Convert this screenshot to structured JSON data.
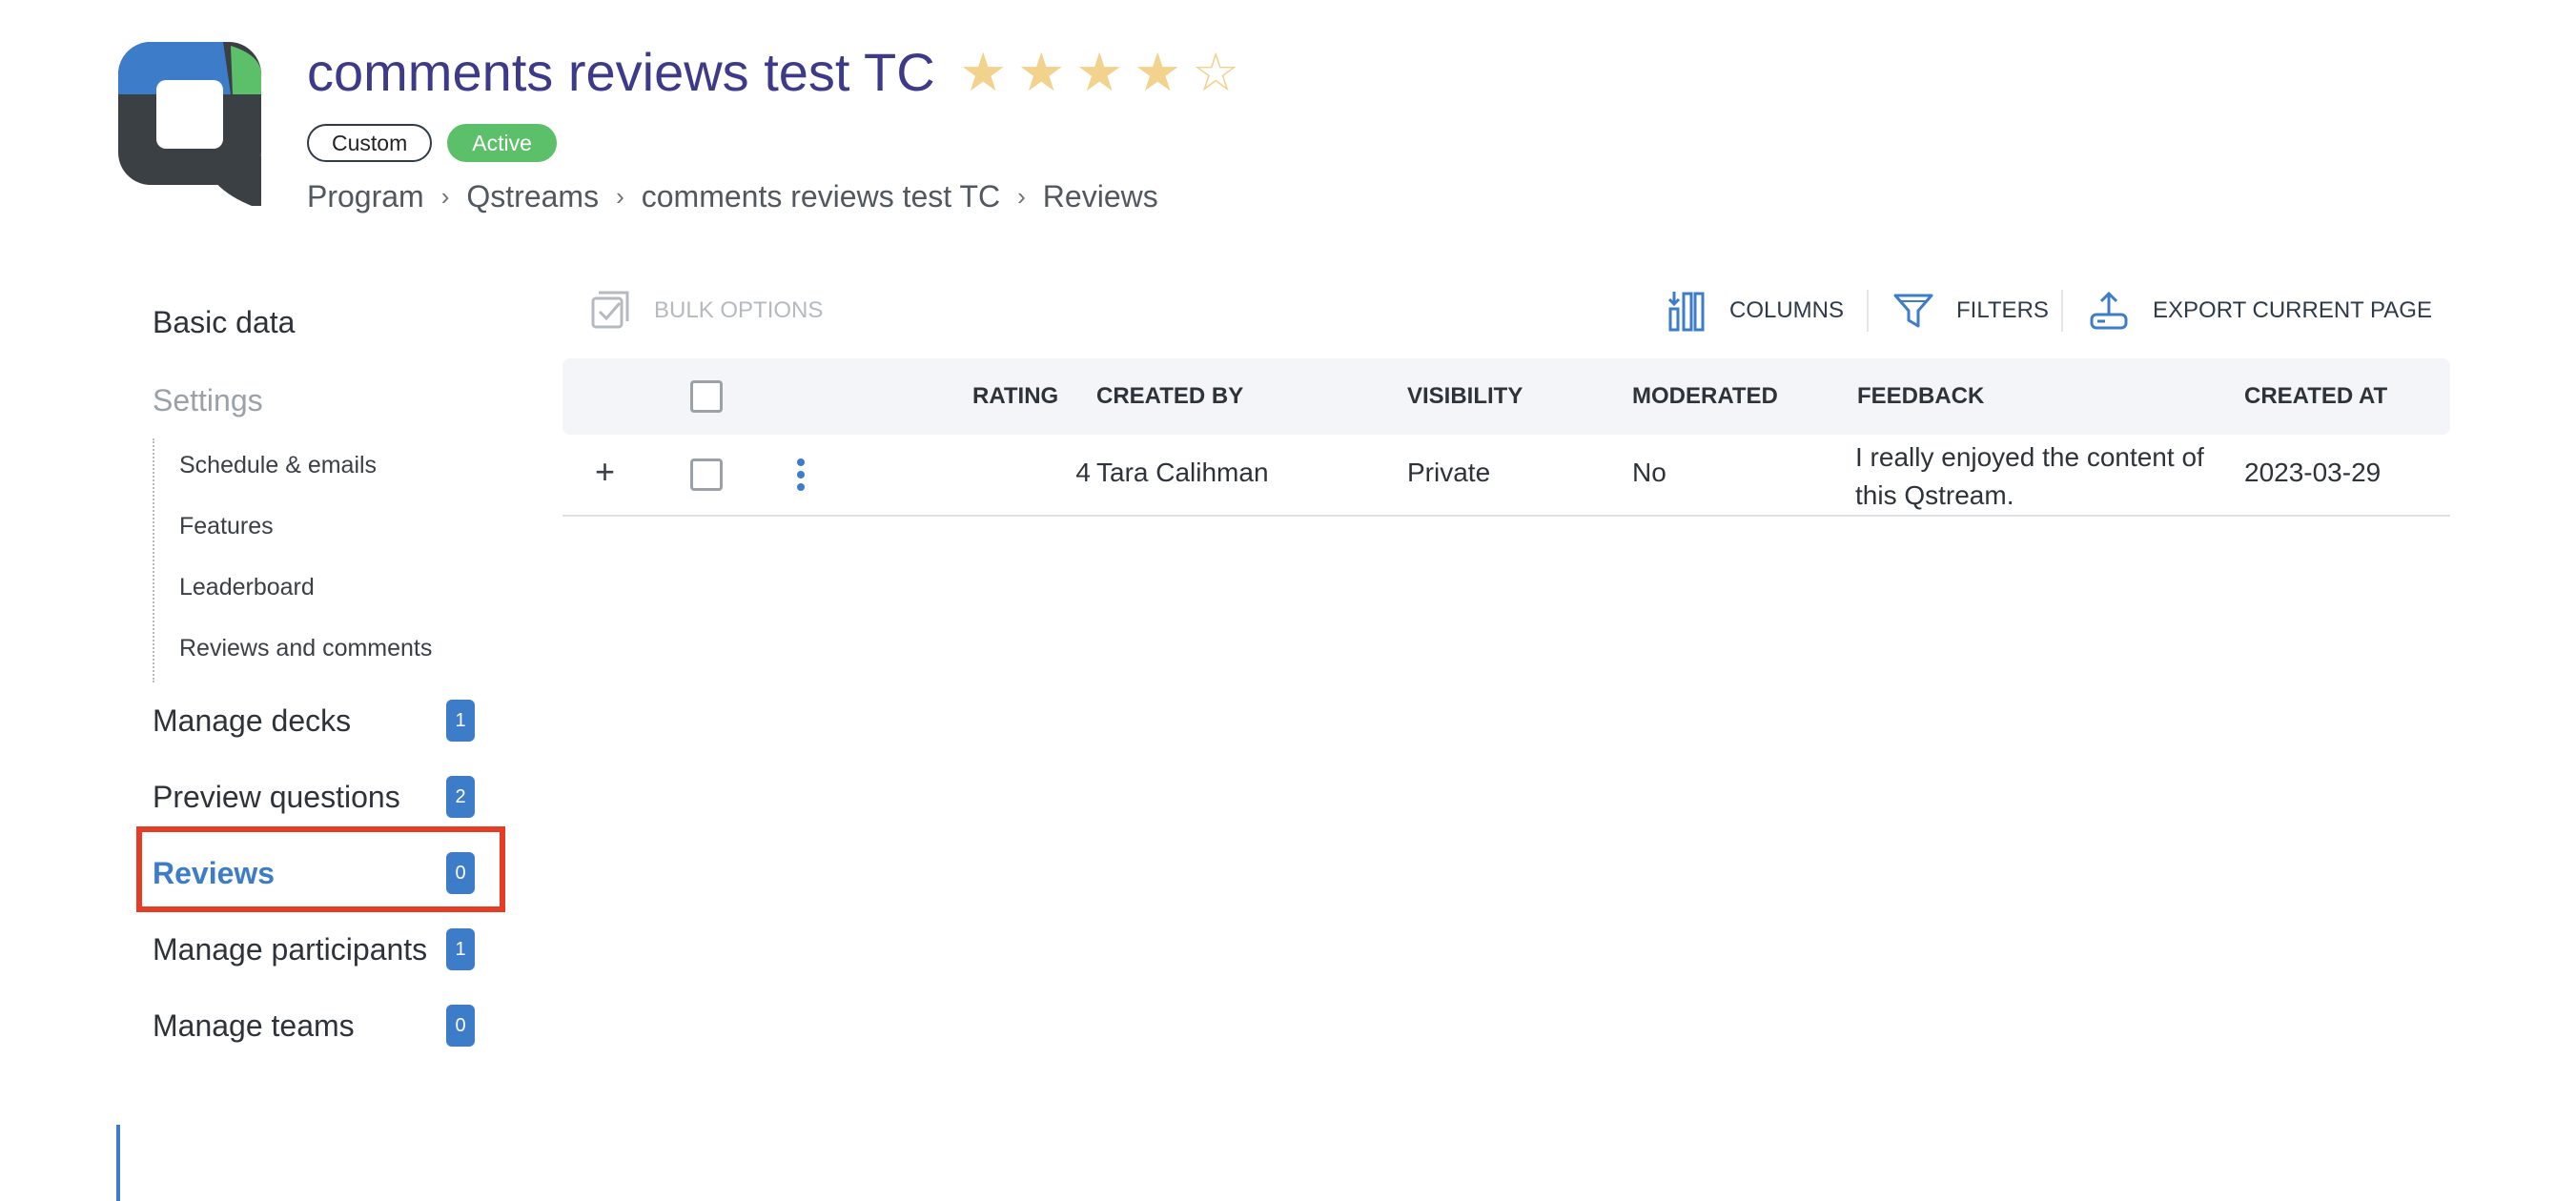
{
  "header": {
    "title": "comments reviews test TC",
    "rating": 4,
    "rating_max": 5,
    "stars": [
      "★",
      "★",
      "★",
      "★",
      "☆"
    ],
    "badges": {
      "custom": "Custom",
      "active": "Active"
    },
    "breadcrumb": [
      "Program",
      "Qstreams",
      "comments reviews test TC",
      "Reviews"
    ],
    "breadcrumb_separator": "›"
  },
  "colors": {
    "title": "#3d3a8a",
    "accent": "#3d7cc9",
    "active_badge": "#5cbf6a",
    "star": "#f2d38e",
    "highlight": "#e53d25",
    "logo_blue": "#3d7cc9",
    "logo_green": "#5cbf6a",
    "logo_dark": "#3a4043"
  },
  "sidebar": {
    "basic_data": "Basic data",
    "settings": "Settings",
    "settings_items": [
      "Schedule & emails",
      "Features",
      "Leaderboard",
      "Reviews and comments"
    ],
    "manage_decks": {
      "label": "Manage decks",
      "count": "1"
    },
    "preview_questions": {
      "label": "Preview questions",
      "count": "2"
    },
    "reviews": {
      "label": "Reviews",
      "count": "0"
    },
    "manage_participants": {
      "label": "Manage participants",
      "count": "1"
    },
    "manage_teams": {
      "label": "Manage teams",
      "count": "0"
    }
  },
  "toolbar": {
    "bulk_options": "BULK OPTIONS",
    "columns": "COLUMNS",
    "filters": "FILTERS",
    "export": "EXPORT CURRENT PAGE"
  },
  "table": {
    "headers": {
      "rating": "RATING",
      "created_by": "CREATED BY",
      "visibility": "VISIBILITY",
      "moderated": "MODERATED",
      "feedback": "FEEDBACK",
      "created_at": "CREATED AT"
    },
    "rows": [
      {
        "expand": "+",
        "rating": "4",
        "created_by": "Tara Calihman",
        "visibility": "Private",
        "moderated": "No",
        "feedback": "I really enjoyed the content of this Qstream.",
        "created_at": "2023-03-29"
      }
    ]
  }
}
